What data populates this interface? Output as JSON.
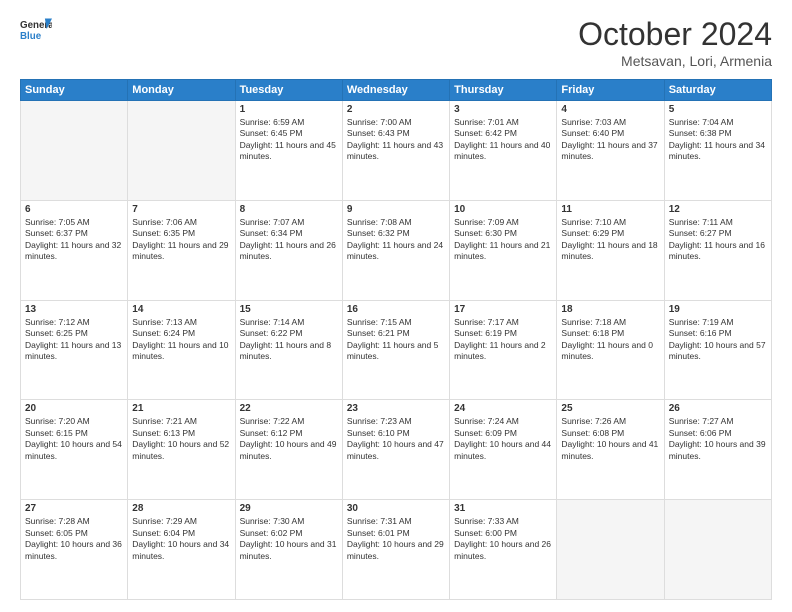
{
  "header": {
    "logo_line1": "General",
    "logo_line2": "Blue",
    "title": "October 2024",
    "location": "Metsavan, Lori, Armenia"
  },
  "days_of_week": [
    "Sunday",
    "Monday",
    "Tuesday",
    "Wednesday",
    "Thursday",
    "Friday",
    "Saturday"
  ],
  "weeks": [
    [
      {
        "day": "",
        "sunrise": "",
        "sunset": "",
        "daylight": "",
        "empty": true
      },
      {
        "day": "",
        "sunrise": "",
        "sunset": "",
        "daylight": "",
        "empty": true
      },
      {
        "day": "1",
        "sunrise": "Sunrise: 6:59 AM",
        "sunset": "Sunset: 6:45 PM",
        "daylight": "Daylight: 11 hours and 45 minutes."
      },
      {
        "day": "2",
        "sunrise": "Sunrise: 7:00 AM",
        "sunset": "Sunset: 6:43 PM",
        "daylight": "Daylight: 11 hours and 43 minutes."
      },
      {
        "day": "3",
        "sunrise": "Sunrise: 7:01 AM",
        "sunset": "Sunset: 6:42 PM",
        "daylight": "Daylight: 11 hours and 40 minutes."
      },
      {
        "day": "4",
        "sunrise": "Sunrise: 7:03 AM",
        "sunset": "Sunset: 6:40 PM",
        "daylight": "Daylight: 11 hours and 37 minutes."
      },
      {
        "day": "5",
        "sunrise": "Sunrise: 7:04 AM",
        "sunset": "Sunset: 6:38 PM",
        "daylight": "Daylight: 11 hours and 34 minutes."
      }
    ],
    [
      {
        "day": "6",
        "sunrise": "Sunrise: 7:05 AM",
        "sunset": "Sunset: 6:37 PM",
        "daylight": "Daylight: 11 hours and 32 minutes."
      },
      {
        "day": "7",
        "sunrise": "Sunrise: 7:06 AM",
        "sunset": "Sunset: 6:35 PM",
        "daylight": "Daylight: 11 hours and 29 minutes."
      },
      {
        "day": "8",
        "sunrise": "Sunrise: 7:07 AM",
        "sunset": "Sunset: 6:34 PM",
        "daylight": "Daylight: 11 hours and 26 minutes."
      },
      {
        "day": "9",
        "sunrise": "Sunrise: 7:08 AM",
        "sunset": "Sunset: 6:32 PM",
        "daylight": "Daylight: 11 hours and 24 minutes."
      },
      {
        "day": "10",
        "sunrise": "Sunrise: 7:09 AM",
        "sunset": "Sunset: 6:30 PM",
        "daylight": "Daylight: 11 hours and 21 minutes."
      },
      {
        "day": "11",
        "sunrise": "Sunrise: 7:10 AM",
        "sunset": "Sunset: 6:29 PM",
        "daylight": "Daylight: 11 hours and 18 minutes."
      },
      {
        "day": "12",
        "sunrise": "Sunrise: 7:11 AM",
        "sunset": "Sunset: 6:27 PM",
        "daylight": "Daylight: 11 hours and 16 minutes."
      }
    ],
    [
      {
        "day": "13",
        "sunrise": "Sunrise: 7:12 AM",
        "sunset": "Sunset: 6:25 PM",
        "daylight": "Daylight: 11 hours and 13 minutes."
      },
      {
        "day": "14",
        "sunrise": "Sunrise: 7:13 AM",
        "sunset": "Sunset: 6:24 PM",
        "daylight": "Daylight: 11 hours and 10 minutes."
      },
      {
        "day": "15",
        "sunrise": "Sunrise: 7:14 AM",
        "sunset": "Sunset: 6:22 PM",
        "daylight": "Daylight: 11 hours and 8 minutes."
      },
      {
        "day": "16",
        "sunrise": "Sunrise: 7:15 AM",
        "sunset": "Sunset: 6:21 PM",
        "daylight": "Daylight: 11 hours and 5 minutes."
      },
      {
        "day": "17",
        "sunrise": "Sunrise: 7:17 AM",
        "sunset": "Sunset: 6:19 PM",
        "daylight": "Daylight: 11 hours and 2 minutes."
      },
      {
        "day": "18",
        "sunrise": "Sunrise: 7:18 AM",
        "sunset": "Sunset: 6:18 PM",
        "daylight": "Daylight: 11 hours and 0 minutes."
      },
      {
        "day": "19",
        "sunrise": "Sunrise: 7:19 AM",
        "sunset": "Sunset: 6:16 PM",
        "daylight": "Daylight: 10 hours and 57 minutes."
      }
    ],
    [
      {
        "day": "20",
        "sunrise": "Sunrise: 7:20 AM",
        "sunset": "Sunset: 6:15 PM",
        "daylight": "Daylight: 10 hours and 54 minutes."
      },
      {
        "day": "21",
        "sunrise": "Sunrise: 7:21 AM",
        "sunset": "Sunset: 6:13 PM",
        "daylight": "Daylight: 10 hours and 52 minutes."
      },
      {
        "day": "22",
        "sunrise": "Sunrise: 7:22 AM",
        "sunset": "Sunset: 6:12 PM",
        "daylight": "Daylight: 10 hours and 49 minutes."
      },
      {
        "day": "23",
        "sunrise": "Sunrise: 7:23 AM",
        "sunset": "Sunset: 6:10 PM",
        "daylight": "Daylight: 10 hours and 47 minutes."
      },
      {
        "day": "24",
        "sunrise": "Sunrise: 7:24 AM",
        "sunset": "Sunset: 6:09 PM",
        "daylight": "Daylight: 10 hours and 44 minutes."
      },
      {
        "day": "25",
        "sunrise": "Sunrise: 7:26 AM",
        "sunset": "Sunset: 6:08 PM",
        "daylight": "Daylight: 10 hours and 41 minutes."
      },
      {
        "day": "26",
        "sunrise": "Sunrise: 7:27 AM",
        "sunset": "Sunset: 6:06 PM",
        "daylight": "Daylight: 10 hours and 39 minutes."
      }
    ],
    [
      {
        "day": "27",
        "sunrise": "Sunrise: 7:28 AM",
        "sunset": "Sunset: 6:05 PM",
        "daylight": "Daylight: 10 hours and 36 minutes."
      },
      {
        "day": "28",
        "sunrise": "Sunrise: 7:29 AM",
        "sunset": "Sunset: 6:04 PM",
        "daylight": "Daylight: 10 hours and 34 minutes."
      },
      {
        "day": "29",
        "sunrise": "Sunrise: 7:30 AM",
        "sunset": "Sunset: 6:02 PM",
        "daylight": "Daylight: 10 hours and 31 minutes."
      },
      {
        "day": "30",
        "sunrise": "Sunrise: 7:31 AM",
        "sunset": "Sunset: 6:01 PM",
        "daylight": "Daylight: 10 hours and 29 minutes."
      },
      {
        "day": "31",
        "sunrise": "Sunrise: 7:33 AM",
        "sunset": "Sunset: 6:00 PM",
        "daylight": "Daylight: 10 hours and 26 minutes."
      },
      {
        "day": "",
        "sunrise": "",
        "sunset": "",
        "daylight": "",
        "empty": true
      },
      {
        "day": "",
        "sunrise": "",
        "sunset": "",
        "daylight": "",
        "empty": true
      }
    ]
  ]
}
